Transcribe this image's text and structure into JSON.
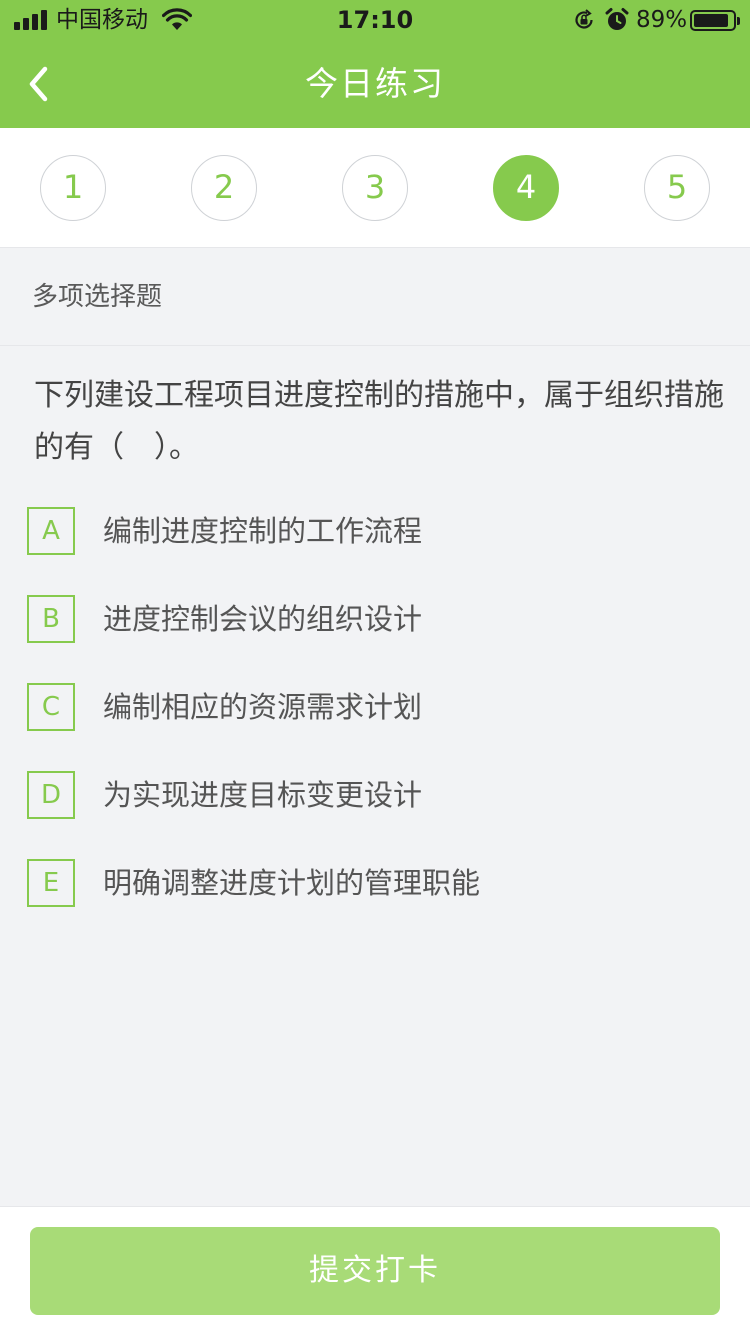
{
  "status_bar": {
    "carrier": "中国移动",
    "time": "17:10",
    "battery_percent": "89%",
    "battery_level": 0.89,
    "icons": [
      "signal-icon",
      "wifi-icon",
      "rotation-lock-icon",
      "alarm-icon",
      "battery-icon"
    ]
  },
  "navbar": {
    "title": "今日练习",
    "back_icon": "chevron-left-icon"
  },
  "steps": {
    "items": [
      "1",
      "2",
      "3",
      "4",
      "5"
    ],
    "active_index": 3
  },
  "question_type": "多项选择题",
  "question": {
    "text": "下列建设工程项目进度控制的措施中，属于组织措施的有（　）。",
    "options": [
      {
        "key": "A",
        "text": "编制进度控制的工作流程"
      },
      {
        "key": "B",
        "text": "进度控制会议的组织设计"
      },
      {
        "key": "C",
        "text": "编制相应的资源需求计划"
      },
      {
        "key": "D",
        "text": "为实现进度目标变更设计"
      },
      {
        "key": "E",
        "text": "明确调整进度计划的管理职能"
      }
    ]
  },
  "submit_label": "提交打卡",
  "colors": {
    "accent": "#86ca4d",
    "button_disabled": "#a8db77",
    "background": "#f2f3f5"
  }
}
